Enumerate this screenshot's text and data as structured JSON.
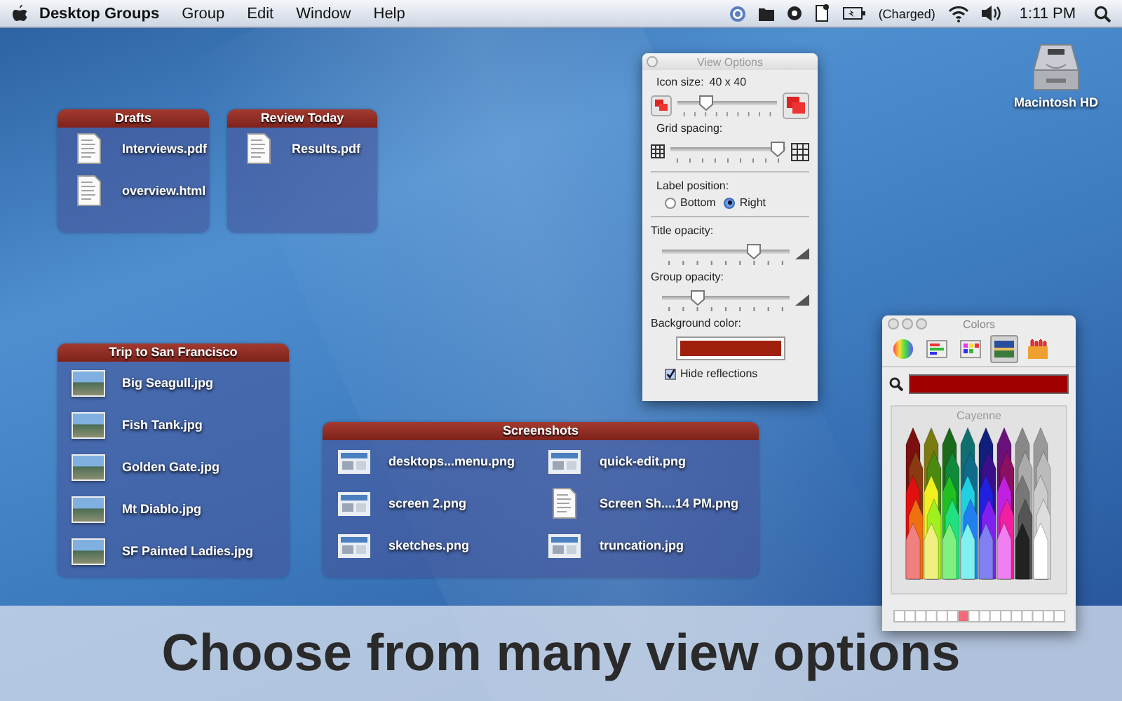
{
  "menu_bar": {
    "app_name": "Desktop Groups",
    "menus": [
      "Group",
      "Edit",
      "Window",
      "Help"
    ],
    "battery_status": "(Charged)",
    "clock": "1:11 PM"
  },
  "desktop_icons": [
    {
      "label": "Macintosh HD"
    }
  ],
  "groups": [
    {
      "title": "Drafts",
      "kind": "list",
      "files": [
        {
          "name": "Interviews.pdf",
          "kind": "document"
        },
        {
          "name": "overview.html",
          "kind": "document"
        }
      ]
    },
    {
      "title": "Review Today",
      "kind": "list",
      "files": [
        {
          "name": "Results.pdf",
          "kind": "document"
        }
      ]
    },
    {
      "title": "Trip to San Francisco",
      "kind": "list",
      "files": [
        {
          "name": "Big Seagull.jpg",
          "kind": "photo"
        },
        {
          "name": "Fish Tank.jpg",
          "kind": "photo"
        },
        {
          "name": "Golden Gate.jpg",
          "kind": "photo"
        },
        {
          "name": "Mt Diablo.jpg",
          "kind": "photo"
        },
        {
          "name": "SF Painted Ladies.jpg",
          "kind": "photo"
        }
      ]
    },
    {
      "title": "Screenshots",
      "kind": "grid",
      "files": [
        {
          "name": "desktops...menu.png",
          "kind": "screenshot"
        },
        {
          "name": "quick-edit.png",
          "kind": "screenshot"
        },
        {
          "name": "screen 2.png",
          "kind": "screenshot"
        },
        {
          "name": "Screen Sh....14 PM.png",
          "kind": "document"
        },
        {
          "name": "sketches.png",
          "kind": "screenshot"
        },
        {
          "name": "truncation.jpg",
          "kind": "screenshot"
        }
      ]
    }
  ],
  "view_options": {
    "title": "View Options",
    "sliders": [
      {
        "kind": "icon-size",
        "label": "Icon size:",
        "reading": "40 x 40",
        "level": 0.25
      },
      {
        "kind": "grid",
        "label": "Grid spacing:",
        "level": 1.0
      }
    ],
    "label_position": {
      "label": "Label position:",
      "options": [
        {
          "label": "Bottom",
          "selected": false
        },
        {
          "label": "Right",
          "selected": true
        }
      ]
    },
    "opacity_sliders": [
      {
        "kind": "opacity",
        "label": "Title opacity:",
        "level": 0.75
      },
      {
        "kind": "opacity",
        "label": "Group opacity:",
        "level": 0.25
      }
    ],
    "background_color": {
      "label": "Background color:",
      "color": "#a0200e"
    },
    "hide_reflections": {
      "label": "Hide reflections",
      "checked": true
    }
  },
  "colors_panel": {
    "title": "Colors",
    "tabs": [
      {
        "kind": "wheel",
        "selected": false
      },
      {
        "kind": "sliders",
        "selected": false
      },
      {
        "kind": "palettes",
        "selected": false
      },
      {
        "kind": "image",
        "selected": true
      },
      {
        "kind": "crayons",
        "selected": false
      }
    ],
    "color": "#a00000",
    "crayon_name": "Cayenne"
  },
  "caption": "Choose from many view options"
}
